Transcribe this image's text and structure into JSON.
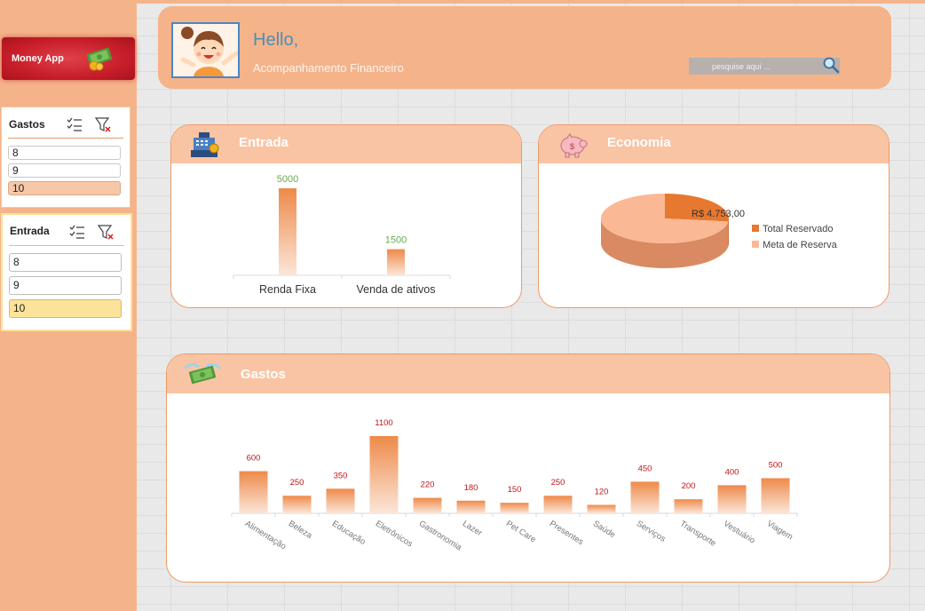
{
  "sidebar": {
    "brand": "Money App",
    "slicers": [
      {
        "title": "Gastos",
        "items": [
          "8",
          "9",
          "10"
        ],
        "selected": "10"
      },
      {
        "title": "Entrada",
        "items": [
          "8",
          "9",
          "10"
        ],
        "selected": "10"
      }
    ]
  },
  "header": {
    "greeting": "Hello,",
    "subtitle": "Acompanhamento Financeiro",
    "search_placeholder": "pesquise aqui ..."
  },
  "cards": {
    "entrada": {
      "title": "Entrada"
    },
    "economia": {
      "title": "Economia"
    },
    "gastos": {
      "title": "Gastos"
    }
  },
  "colors": {
    "accent": "#f5b38a",
    "bar": "#ee8a4a",
    "value_green": "#6aa84f",
    "value_red": "#c0171b"
  },
  "chart_data": [
    {
      "type": "bar",
      "categories": [
        "Renda Fixa",
        "Venda de ativos"
      ],
      "values": [
        5000,
        1500
      ]
    },
    {
      "type": "pie",
      "labels": [
        "Total Reservado",
        "Meta de Reserva"
      ],
      "values": [
        27,
        73
      ],
      "data_label": "R$ 4.753,00",
      "legend": "right",
      "colors": [
        "#e6782f",
        "#fbb894"
      ]
    },
    {
      "type": "bar",
      "categories": [
        "Alimentação",
        "Beleza",
        "Educação",
        "Eletrônicos",
        "Gastronomia",
        "Lazer",
        "Pet Care",
        "Presentes",
        "Saúde",
        "Serviços",
        "Transporte",
        "Vestuário",
        "Viagem"
      ],
      "values": [
        600,
        250,
        350,
        1100,
        220,
        180,
        150,
        250,
        120,
        450,
        200,
        400,
        500
      ]
    }
  ]
}
